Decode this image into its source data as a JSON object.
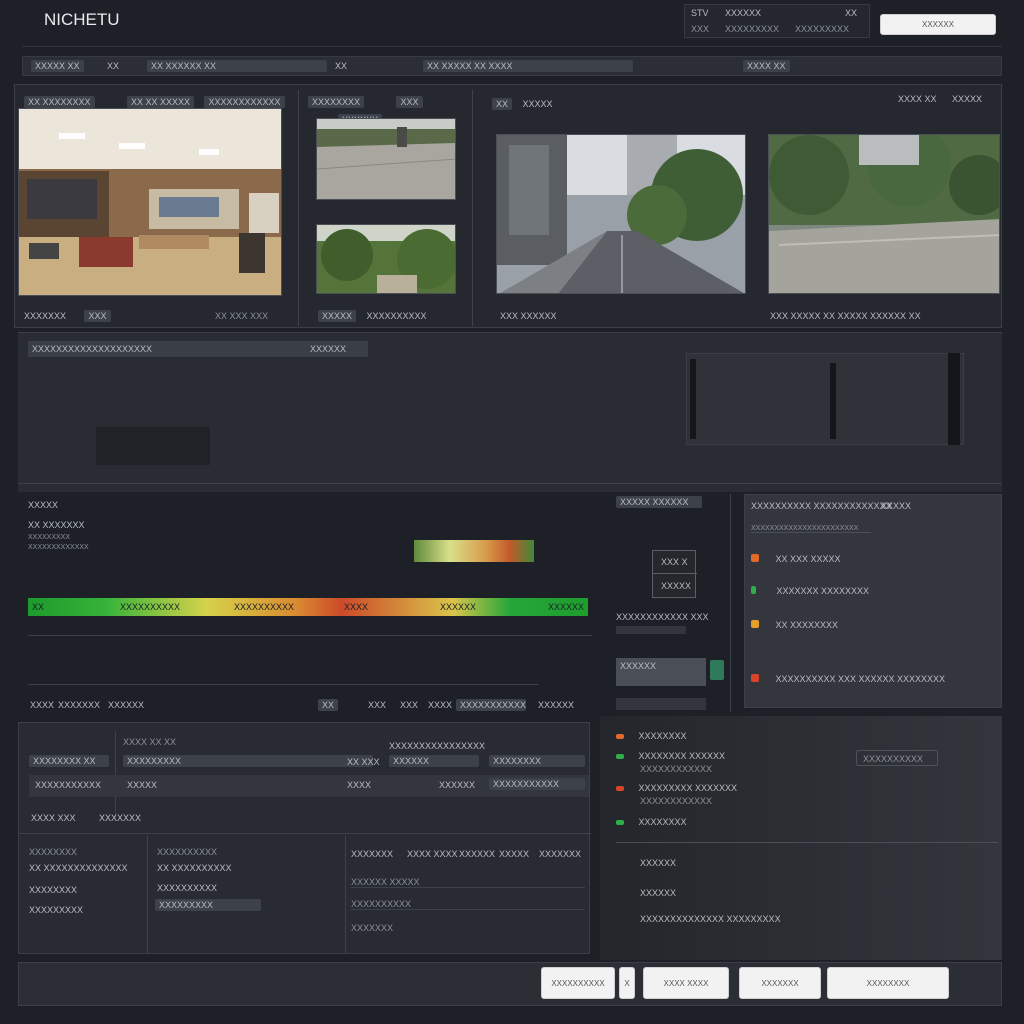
{
  "app": {
    "title": "NICHETU",
    "top_button": "XXXXXX"
  },
  "top_status": {
    "line1": [
      "STV",
      "XXXXXX",
      "XX"
    ],
    "line2": [
      "XXX",
      "XXXXXXXXX",
      "XXXXXXXXX"
    ]
  },
  "toolbar": {
    "items": [
      "XXXXX XX",
      "XX",
      "XX XXXXXX XX",
      "XX",
      "XX XXXXX XX XXXX",
      "XXXX XX"
    ]
  },
  "cameras": {
    "group1": {
      "header": [
        "XX XXXXXXXX",
        "XX XX XXXXX",
        "XXXXXXXXXXXX"
      ],
      "footer": [
        "XXXXXXX",
        "XXX",
        "XX XXX XXX"
      ]
    },
    "group2": {
      "header": [
        "XXXXXXXX",
        "XXX",
        "XXXXXX"
      ],
      "footer": [
        "XXXXX",
        "XXXXXXXXXX"
      ]
    },
    "group3": {
      "header": [
        "XX",
        "XXXXX",
        "XXXX XX",
        "XXXXX"
      ],
      "footer_left": "XXX XXXXXX",
      "footer_right": "XXX XXXXX XX XXXXX XXXXXX XX"
    }
  },
  "timeline": {
    "header": "XXXXXXXXXXXXXXXXXXXX",
    "header_right": "XXXXXX"
  },
  "analysis": {
    "title": "XXXXX",
    "sub": "XX XXXXXXX",
    "small_lines": [
      "XXXXXXXXX",
      "XXXXXXXXXXXXX"
    ],
    "spectrum_labels": [
      "XX",
      "XXXXXXXXXX",
      "XXXXXXXXXX",
      "XXXX",
      "XXXXXX",
      "XXXXXX"
    ],
    "level_percent": 100,
    "tabs": [
      "XXXX",
      "XXXXXXX",
      "XXXXXX",
      "XX",
      "XXX",
      "XXX",
      "XXXX",
      "XXXXXXXXXXX",
      "XXXXXX"
    ]
  },
  "table": {
    "caption": "XXXX XX XX",
    "group_caption": "XXXXXXXXXXXXXXXX",
    "rows": [
      [
        "XXXXXXXX XX",
        "XXXXXXXXX",
        "XX XXX",
        "XXXXXX",
        "XXXXXXXX"
      ],
      [
        "XXXXXXXXXXX",
        "XXXXX",
        "XXXX",
        "XXXXXX",
        "XXXXXXXXXXX"
      ]
    ],
    "footer": [
      "XXXX XXX",
      "XXXXXXX"
    ]
  },
  "lower_lists": {
    "left": [
      "XXXXXXXX",
      "XX XXXXXXXXXXXXXX",
      "XXXXXXXX",
      "XXXXXXXXX"
    ],
    "middle": [
      "XXXXXXXXXX",
      "XX XXXXXXXXXX",
      "XXXXXXXXXX",
      "XXXXXXXXX"
    ],
    "right_headers": [
      "XXXXXXX",
      "XXXX XXXX",
      "XXXXXX",
      "XXXXX",
      "XXXXXXX"
    ],
    "right_rows": [
      "XXXXXX XXXXX",
      "XXXXXXXXXX",
      "XXXXXXX"
    ]
  },
  "side_mini": {
    "header": "XXXXX XXXXXX",
    "box": [
      "XXX X",
      "XXXXX"
    ],
    "label": "XXXXXXXXXXXX XXX",
    "label2": "XXXXXX"
  },
  "alerts": {
    "header": "XXXXXXXXXX XXXXXXXXXXXXX",
    "header_right": "XXXXX",
    "sub": "XXXXXXXXXXXXXXXXXXXXXXX",
    "items": [
      {
        "text": "XX XXX XXXXX",
        "color": "#e06a2a"
      },
      {
        "text": "XXXXXXX XXXXXXXX",
        "color": "#2fae4a"
      },
      {
        "text": "XX XXXXXXXX",
        "color": "#e0a02a"
      },
      {
        "text": "XXXXXXXXXX XXX XXXXXX XXXXXXXX",
        "color": "#d8442a"
      }
    ]
  },
  "events": {
    "items": [
      {
        "title": "XXXXXXXX",
        "sub": "",
        "color": "#e06a2a"
      },
      {
        "title": "XXXXXXXX XXXXXX",
        "sub": "XXXXXXXXXXXX",
        "color": "#2fae4a"
      },
      {
        "title": "XXXXXXXXX XXXXXXX",
        "sub": "XXXXXXXXXXXX",
        "color": "#d8442a"
      },
      {
        "title": "XXXXXXXX",
        "sub": "",
        "color": "#2fae4a"
      }
    ],
    "action_button": "XXXXXXXXXX",
    "summary": [
      "XXXXXX",
      "XXXXXX",
      "XXXXXXXXXXXXXX XXXXXXXXX"
    ]
  },
  "bottom_buttons": [
    "XXXXXXXXXX",
    "X",
    "XXXX XXXX",
    "XXXXXXX",
    "XXXXXXXX"
  ],
  "colors": {
    "bg": "#1d2027",
    "panel": "#2a2d34",
    "accent_green": "#2fae4a",
    "accent_red": "#d8442a",
    "accent_yellow": "#d8c84a"
  }
}
